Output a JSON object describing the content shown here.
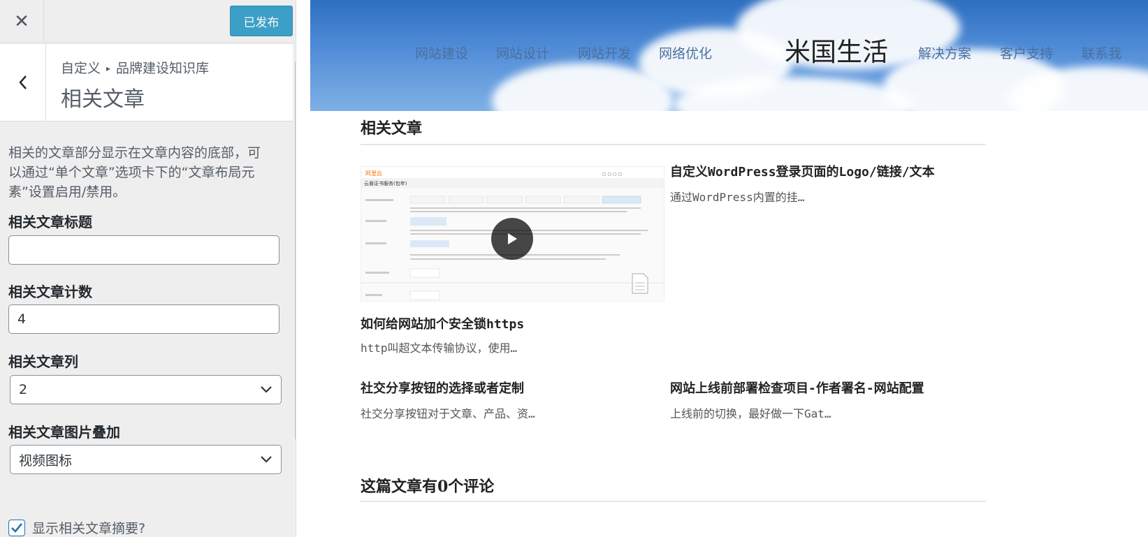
{
  "sidebar": {
    "publish_label": "已发布",
    "breadcrumb": {
      "root": "自定义",
      "section": "品牌建设知识库"
    },
    "section_title": "相关文章",
    "description": "相关的文章部分显示在文章内容的底部，可以通过“单个文章”选项卡下的“文章布局元素”设置启用/禁用。",
    "fields": {
      "title_label": "相关文章标题",
      "title_value": "",
      "count_label": "相关文章计数",
      "count_value": "4",
      "columns_label": "相关文章列",
      "columns_value": "2",
      "overlay_label": "相关文章图片叠加",
      "overlay_value": "视频图标",
      "excerpt_label": "显示相关文章摘要?",
      "excerpt_checked": true
    },
    "accent_color": "#0085ba"
  },
  "preview": {
    "site_title": "米国生活",
    "nav_left": [
      "网站建设",
      "网站设计",
      "网站开发",
      "网络优化"
    ],
    "nav_right": [
      "解决方案",
      "客户支持",
      "联系我"
    ],
    "related_heading": "相关文章",
    "posts": [
      {
        "title": "自定义WordPress登录页面的Logo/链接/文本",
        "excerpt": "通过WordPress内置的挂…"
      },
      {
        "title": "如何给网站加个安全锁https",
        "excerpt": "http叫超文本传输协议，使用…"
      },
      {
        "title": "社交分享按钮的选择或者定制",
        "excerpt": "社交分享按钮对于文章、产品、资…"
      },
      {
        "title": "网站上线前部署检查项目-作者署名-网站配置",
        "excerpt": "上线前的切换，最好做一下Gat…"
      }
    ],
    "thumbnail": {
      "logo_text": "阿里云",
      "caption": "云盾证书服务(包年)",
      "overlay_icon": "play-icon"
    },
    "comments_heading": "这篇文章有0个评论"
  }
}
